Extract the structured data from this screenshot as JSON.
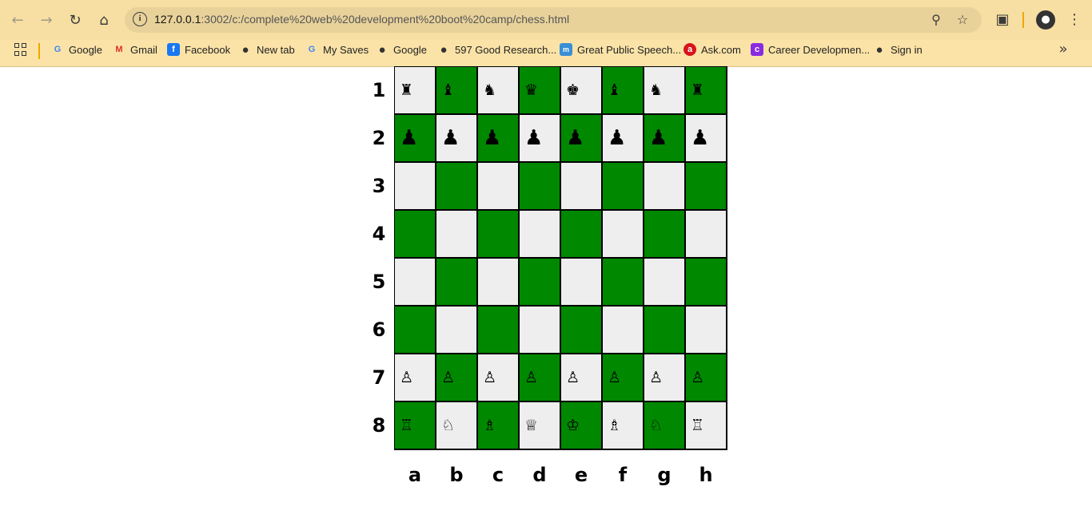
{
  "browser": {
    "url_host": "127.0.0.1",
    "url_path": ":3002/c:/complete%20web%20development%20boot%20camp/chess.html",
    "icons": [
      "back-icon",
      "forward-icon",
      "reload-icon",
      "home-icon",
      "info-icon",
      "zoom-icon",
      "star-icon",
      "extensions-icon",
      "menu-icon"
    ]
  },
  "bookmarks": [
    {
      "label": "Google",
      "icon": "google-icon"
    },
    {
      "label": "Gmail",
      "icon": "gmail-icon"
    },
    {
      "label": "Facebook",
      "icon": "facebook-icon"
    },
    {
      "label": "New tab",
      "icon": "globe-icon"
    },
    {
      "label": "My Saves",
      "icon": "google-icon"
    },
    {
      "label": "Google",
      "icon": "globe-icon"
    },
    {
      "label": "597 Good Research...",
      "icon": "globe-icon"
    },
    {
      "label": "Great Public Speech...",
      "icon": "msc-icon"
    },
    {
      "label": "Ask.com",
      "icon": "ask-icon"
    },
    {
      "label": "Career Developmen...",
      "icon": "career-icon"
    },
    {
      "label": "Sign in",
      "icon": "globe-icon"
    }
  ],
  "board": {
    "ranks": [
      "1",
      "2",
      "3",
      "4",
      "5",
      "6",
      "7",
      "8"
    ],
    "files": [
      "a",
      "b",
      "c",
      "d",
      "e",
      "f",
      "g",
      "h"
    ],
    "light_color": "#eeeeee",
    "dark_color": "#008800",
    "rows": [
      [
        "♜",
        "♝",
        "♞",
        "♛",
        "♚",
        "♝",
        "♞",
        "♜"
      ],
      [
        "♟",
        "♟",
        "♟",
        "♟",
        "♟",
        "♟",
        "♟",
        "♟"
      ],
      [
        "",
        "",
        "",
        "",
        "",
        "",
        "",
        ""
      ],
      [
        "",
        "",
        "",
        "",
        "",
        "",
        "",
        ""
      ],
      [
        "",
        "",
        "",
        "",
        "",
        "",
        "",
        ""
      ],
      [
        "",
        "",
        "",
        "",
        "",
        "",
        "",
        ""
      ],
      [
        "♙",
        "♙",
        "♙",
        "♙",
        "♙",
        "♙",
        "♙",
        "♙"
      ],
      [
        "♖",
        "♘",
        "♗",
        "♕",
        "♔",
        "♗",
        "♘",
        "♖"
      ]
    ]
  }
}
